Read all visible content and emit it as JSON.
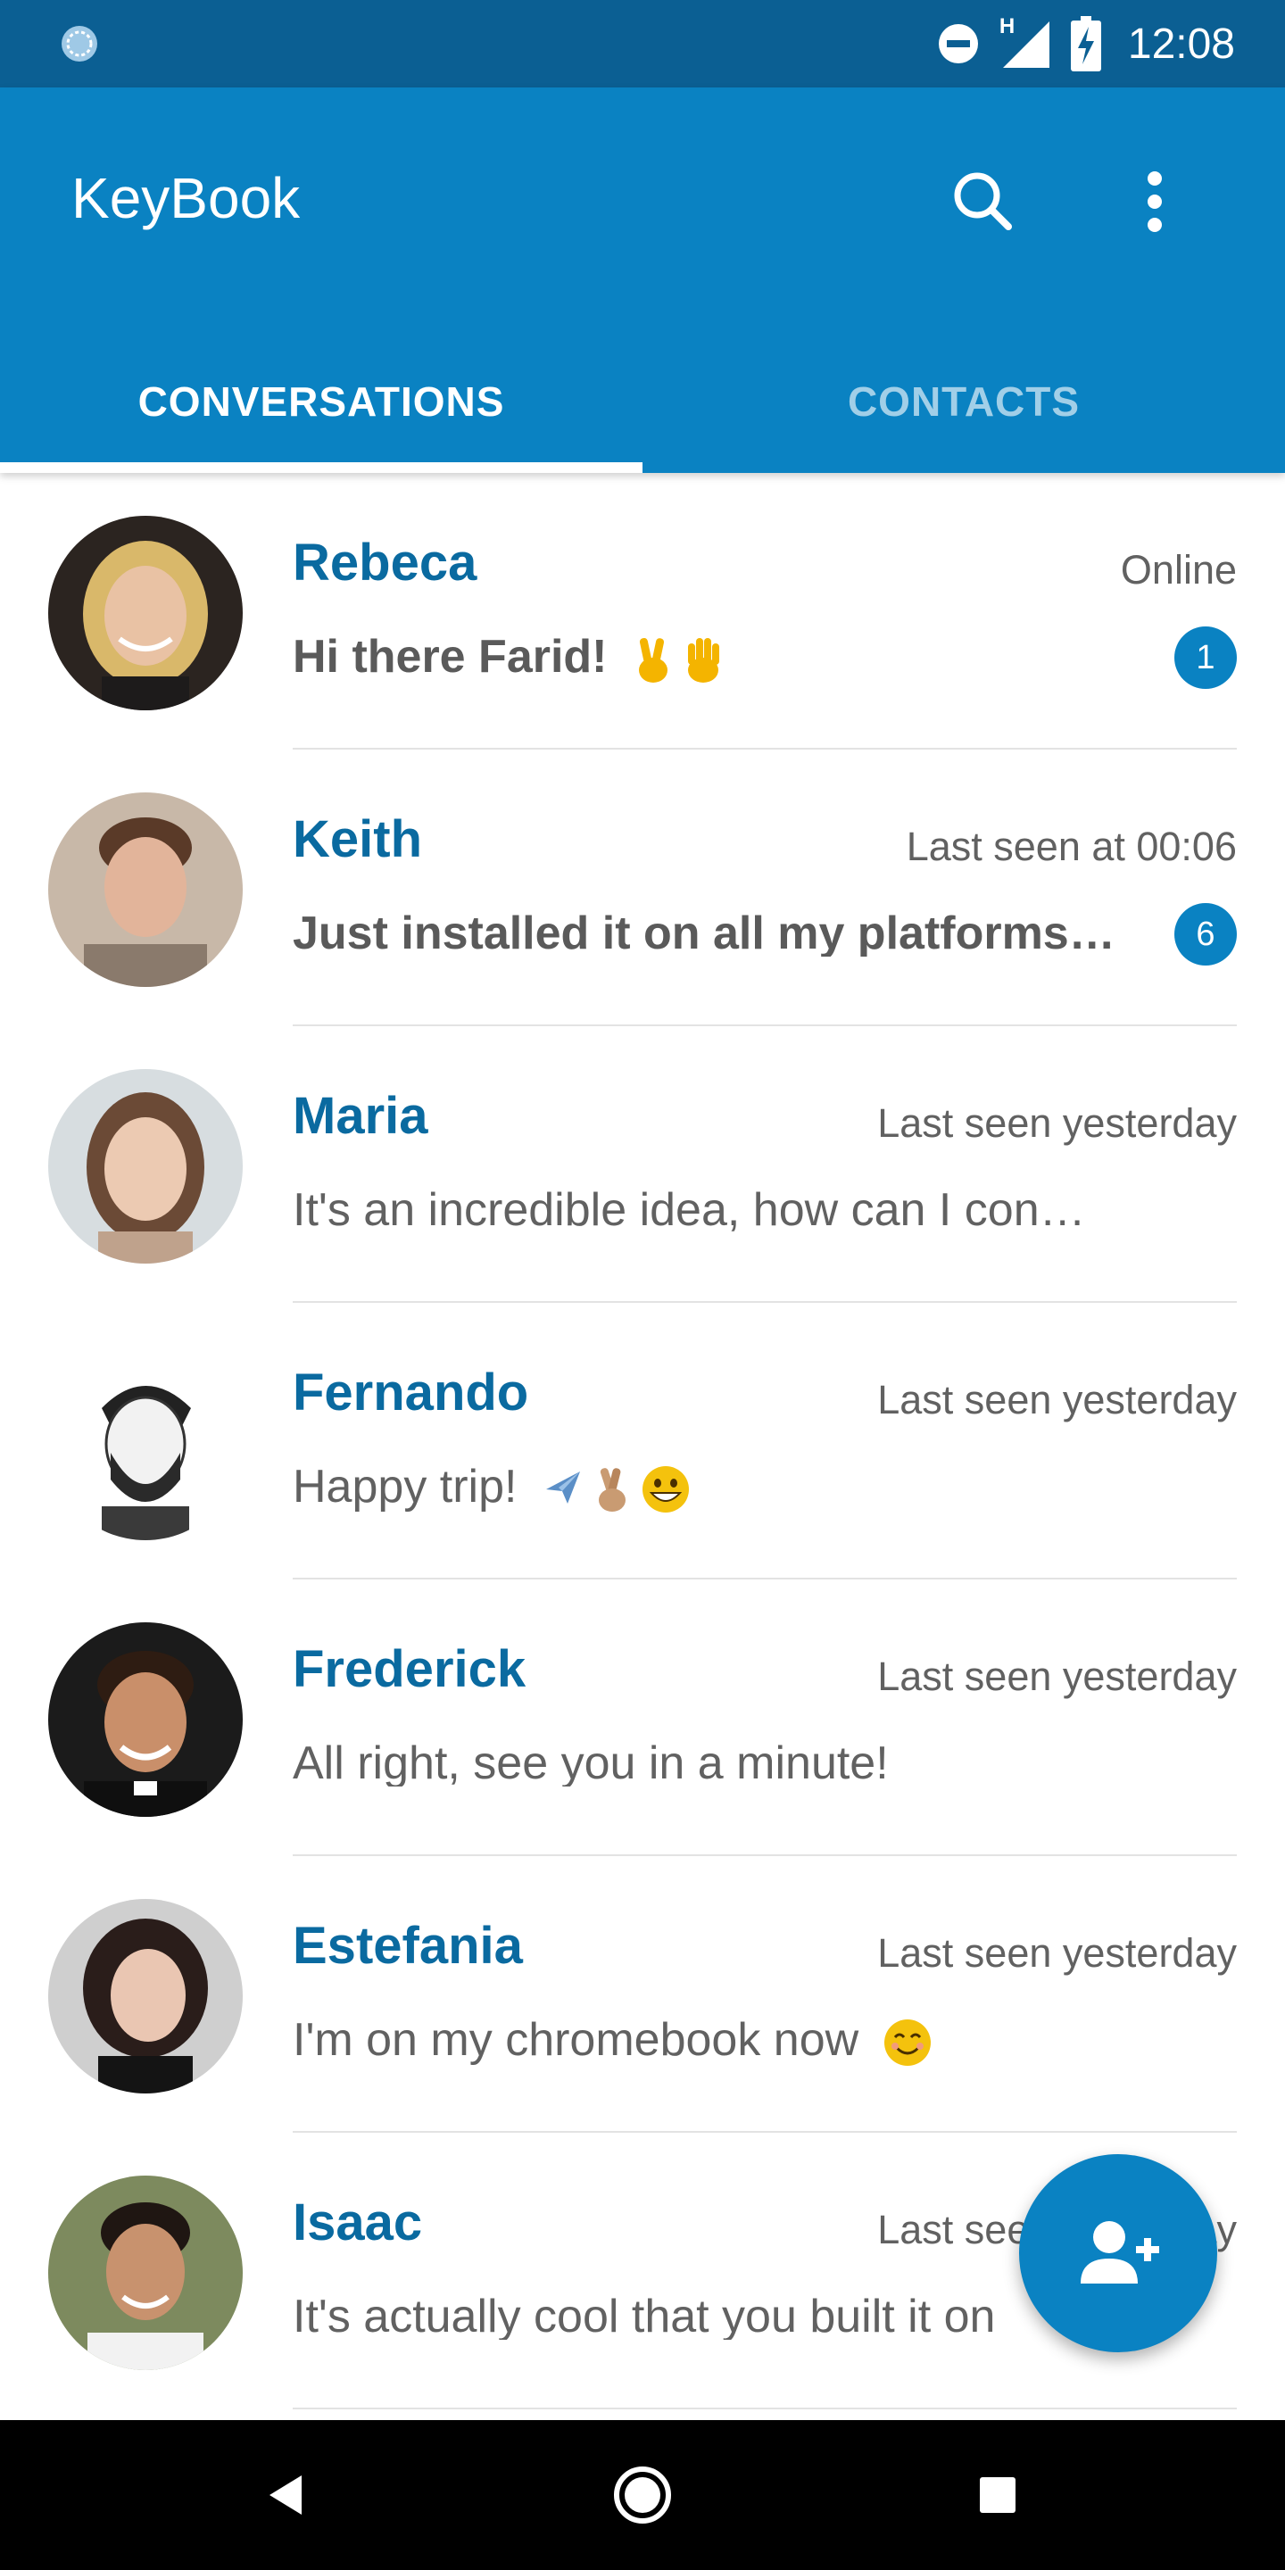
{
  "status_bar": {
    "time": "12:08",
    "network_label": "H",
    "icons": [
      "sync-icon",
      "do-not-disturb-icon",
      "signal-icon",
      "battery-charging-icon"
    ]
  },
  "app_bar": {
    "title": "KeyBook",
    "actions": [
      "search-icon",
      "more-vert-icon"
    ]
  },
  "tabs": [
    {
      "label": "CONVERSATIONS",
      "active": true
    },
    {
      "label": "CONTACTS",
      "active": false
    }
  ],
  "conversations": [
    {
      "name": "Rebeca",
      "status": "Online",
      "message": "Hi there Farid!",
      "emojis": [
        "victory-hand",
        "raised-hand"
      ],
      "unread": true,
      "badge": "1"
    },
    {
      "name": "Keith",
      "status": "Last seen at 00:06",
      "message": "Just installed it on all my platforms…",
      "emojis": [],
      "unread": true,
      "badge": "6"
    },
    {
      "name": "Maria",
      "status": "Last seen yesterday",
      "message": "It's an incredible idea, how can I con…",
      "emojis": [],
      "unread": false,
      "badge": ""
    },
    {
      "name": "Fernando",
      "status": "Last seen yesterday",
      "message": "Happy trip!",
      "emojis": [
        "airplane",
        "crossed-fingers",
        "grinning-face"
      ],
      "unread": false,
      "badge": ""
    },
    {
      "name": "Frederick",
      "status": "Last seen yesterday",
      "message": "All right, see you in a minute!",
      "emojis": [],
      "unread": false,
      "badge": ""
    },
    {
      "name": "Estefania",
      "status": "Last seen yesterday",
      "message": "I'm on my chromebook now",
      "emojis": [
        "smiling-face"
      ],
      "unread": false,
      "badge": ""
    },
    {
      "name": "Isaac",
      "status": "Last seen yesterday",
      "message": "It's actually cool that you built it on",
      "emojis": [],
      "unread": false,
      "badge": ""
    }
  ],
  "fab": {
    "icon": "add-contact-icon"
  },
  "nav_bar": {
    "icons": [
      "back-icon",
      "home-icon",
      "recents-icon"
    ]
  },
  "colors": {
    "status_bar": "#0b5f93",
    "primary": "#0a82c2",
    "name_text": "#0a6aa0",
    "secondary_text": "#616161"
  }
}
